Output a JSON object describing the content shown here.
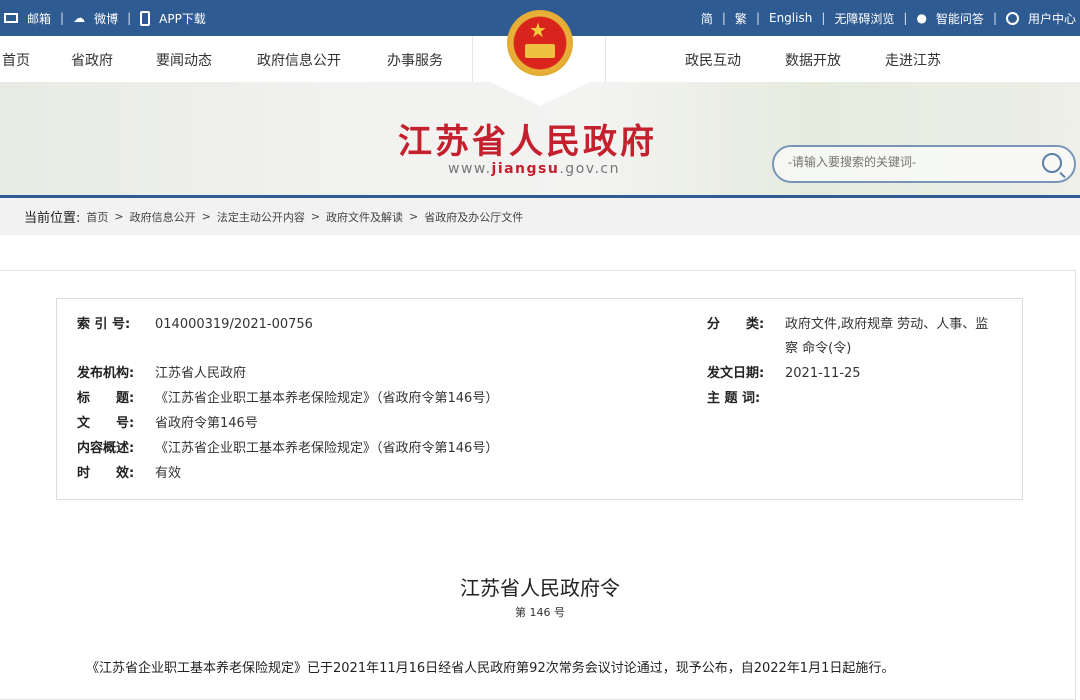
{
  "topbar": {
    "left": [
      "邮箱",
      "微博",
      "APP下载"
    ],
    "right": [
      "简",
      "繁",
      "English",
      "无障碍浏览",
      "智能问答",
      "用户中心"
    ]
  },
  "nav": {
    "left": [
      "首页",
      "省政府",
      "要闻动态",
      "政府信息公开",
      "办事服务"
    ],
    "right": [
      "政民互动",
      "数据开放",
      "走进江苏"
    ]
  },
  "site": {
    "title": "江苏省人民政府",
    "url_pre": "www.",
    "url_mid": "jiangsu",
    "url_post": ".gov.cn"
  },
  "search": {
    "placeholder": "-请输入要搜索的关键词-"
  },
  "breadcrumb": {
    "label": "当前位置:",
    "items": [
      "首页",
      "政府信息公开",
      "法定主动公开内容",
      "政府文件及解读",
      "省政府及办公厅文件"
    ]
  },
  "info": {
    "index_k": "索 引 号:",
    "index_v": "014000319/2021-00756",
    "cat_k": "分　　类:",
    "cat_v1": "政府文件,政府规章 劳动、人事、监",
    "cat_v2": "察 命令(令)",
    "org_k": "发布机构:",
    "org_v": "江苏省人民政府",
    "date_k": "发文日期:",
    "date_v": "2021-11-25",
    "title_k": "标　　题:",
    "title_v": "《江苏省企业职工基本养老保险规定》（省政府令第146号）",
    "kw_k": "主 题 词:",
    "kw_v": "",
    "no_k": "文　　号:",
    "no_v": "省政府令第146号",
    "sum_k": "内容概述:",
    "sum_v": "《江苏省企业职工基本养老保险规定》（省政府令第146号）",
    "eff_k": "时　　效:",
    "eff_v": "有效"
  },
  "doc": {
    "title": "江苏省人民政府令",
    "number": "第 146 号",
    "para": "《江苏省企业职工基本养老保险规定》已于2021年11月16日经省人民政府第92次常务会议讨论通过，现予公布，自2022年1月1日起施行。"
  },
  "colors": {
    "brand": "#2f5b93",
    "title_red": "#c4202e"
  }
}
